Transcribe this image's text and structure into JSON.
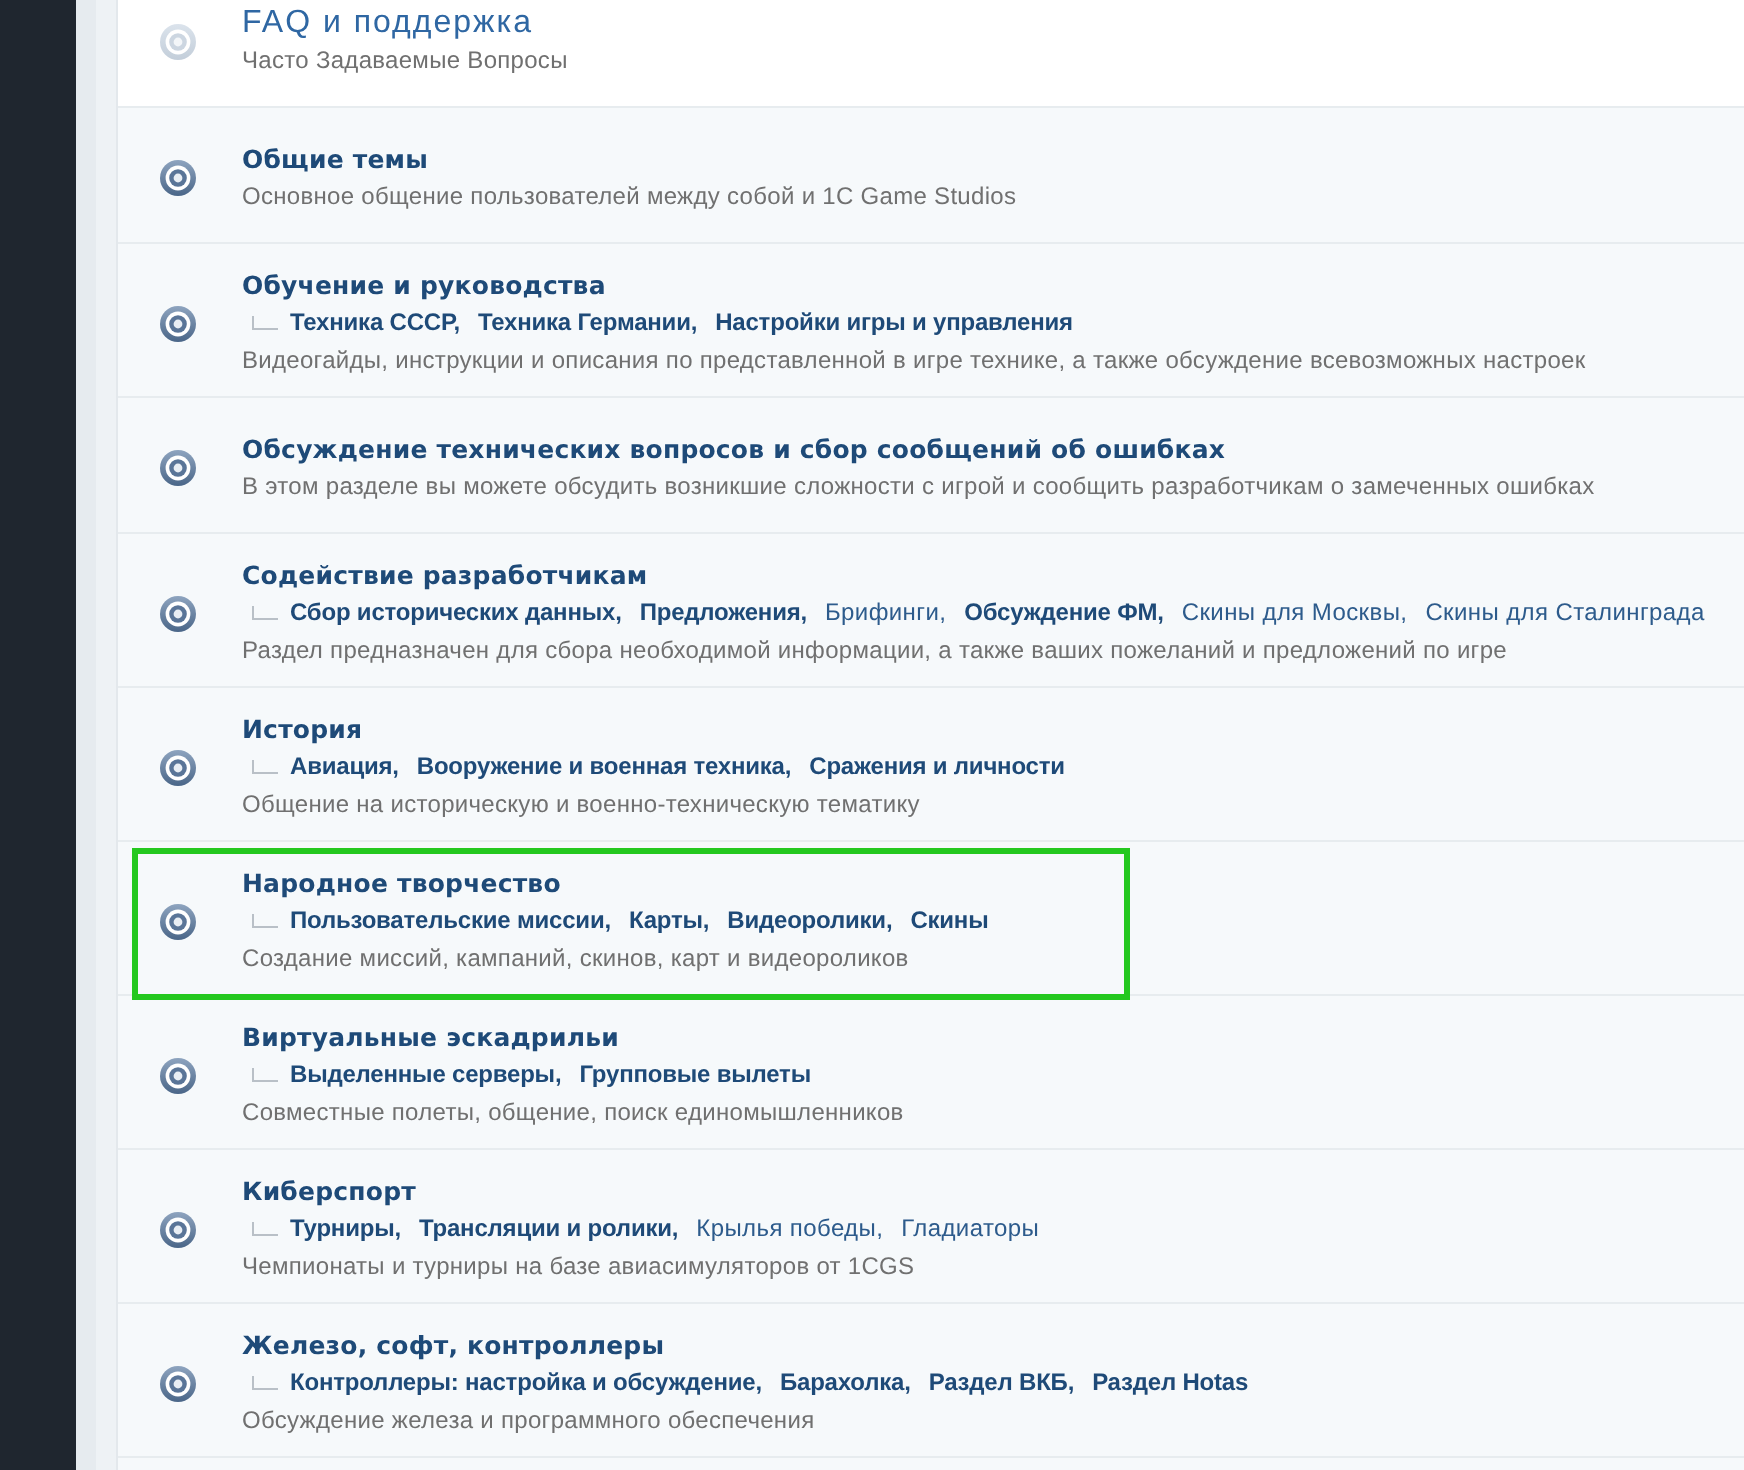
{
  "forums": [
    {
      "title": "FAQ и поддержка",
      "unread": false,
      "highlighted": false,
      "description": "Часто Задаваемые Вопросы"
    },
    {
      "title": "Общие темы",
      "unread": true,
      "highlighted": false,
      "description": "Основное общение пользователей между собой и 1C Game Studios"
    },
    {
      "title": "Обучение и руководства",
      "unread": true,
      "highlighted": false,
      "subforums": [
        {
          "name": "Техника СССР,",
          "unread": true
        },
        {
          "name": "Техника Германии,",
          "unread": true
        },
        {
          "name": "Настройки игры и управления",
          "unread": true
        }
      ],
      "description": "Видеогайды, инструкции и описания по представленной в игре технике, а также обсуждение всевозможных настроек"
    },
    {
      "title": "Обсуждение технических вопросов и сбор сообщений об ошибках",
      "unread": true,
      "highlighted": false,
      "description": "В этом разделе вы можете обсудить возникшие сложности с игрой и сообщить разработчикам о замеченных ошибках"
    },
    {
      "title": "Содействие разработчикам",
      "unread": true,
      "highlighted": false,
      "subforums": [
        {
          "name": "Сбор исторических данных,",
          "unread": true
        },
        {
          "name": "Предложения,",
          "unread": true
        },
        {
          "name": "Брифинги,",
          "unread": false
        },
        {
          "name": "Обсуждение ФМ,",
          "unread": true
        },
        {
          "name": "Скины для Москвы,",
          "unread": false
        },
        {
          "name": "Скины для Сталинграда",
          "unread": false
        }
      ],
      "description": "Раздел предназначен для сбора необходимой информации, а также ваших пожеланий и предложений по игре"
    },
    {
      "title": "История",
      "unread": true,
      "highlighted": false,
      "subforums": [
        {
          "name": "Авиация,",
          "unread": true
        },
        {
          "name": "Вооружение и военная техника,",
          "unread": true
        },
        {
          "name": "Сражения и личности",
          "unread": true
        }
      ],
      "description": "Общение на историческую и военно-техническую тематику"
    },
    {
      "title": "Народное творчество",
      "unread": true,
      "highlighted": true,
      "subforums": [
        {
          "name": "Пользовательские миссии,",
          "unread": true
        },
        {
          "name": "Карты,",
          "unread": true
        },
        {
          "name": "Видеоролики,",
          "unread": true
        },
        {
          "name": "Скины",
          "unread": true
        }
      ],
      "description": "Создание миссий, кампаний, скинов, карт и видеороликов"
    },
    {
      "title": "Виртуальные эскадрильи",
      "unread": true,
      "highlighted": false,
      "subforums": [
        {
          "name": "Выделенные серверы,",
          "unread": true
        },
        {
          "name": "Групповые вылеты",
          "unread": true
        }
      ],
      "description": "Совместные полеты, общение, поиск единомышленников"
    },
    {
      "title": "Киберспорт",
      "unread": true,
      "highlighted": false,
      "subforums": [
        {
          "name": "Турниры,",
          "unread": true
        },
        {
          "name": "Трансляции и ролики,",
          "unread": true
        },
        {
          "name": "Крылья победы,",
          "unread": false
        },
        {
          "name": "Гладиаторы",
          "unread": false
        }
      ],
      "description": "Чемпионаты и турниры на базе авиасимуляторов от 1CGS"
    },
    {
      "title": "Железо, софт, контроллеры",
      "unread": true,
      "highlighted": false,
      "subforums": [
        {
          "name": "Контроллеры: настройка и обсуждение,",
          "unread": true
        },
        {
          "name": "Барахолка,",
          "unread": true
        },
        {
          "name": "Раздел ВКБ,",
          "unread": true
        },
        {
          "name": "Раздел Hotas",
          "unread": true
        }
      ],
      "description": "Обсуждение железа и программного обеспечения"
    }
  ]
}
